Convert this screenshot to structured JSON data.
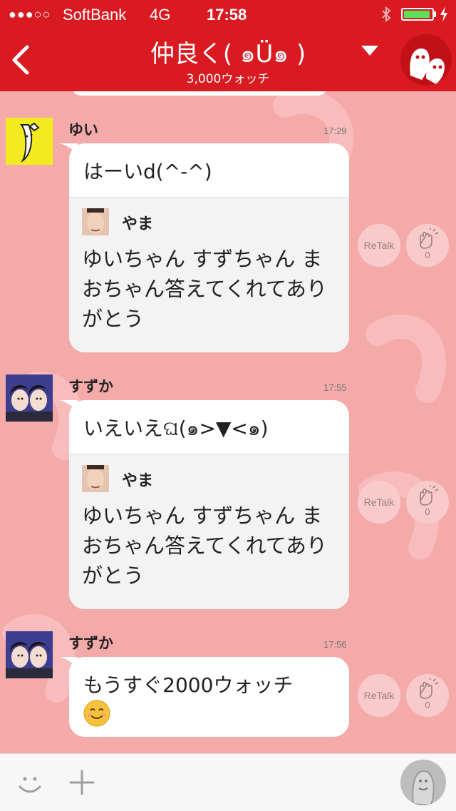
{
  "status_bar": {
    "signal": "●●●○○",
    "carrier": "SoftBank",
    "network": "4G",
    "time": "17:58"
  },
  "header": {
    "title": "仲良く( ๑Ü๑ )",
    "subtitle": "3,000ウォッチ"
  },
  "messages": [
    {
      "user": "ゆい",
      "time": "17:29",
      "text": "はーいd(^-^)",
      "quote": {
        "user": "やま",
        "text": "ゆいちゃん すずちゃん まおちゃん答えてくれてありがとう"
      },
      "retalk_label": "ReTalk",
      "clap_count": "0"
    },
    {
      "user": "すずか",
      "time": "17:55",
      "text": "いえいえଘ(๑>▼<๑)",
      "quote": {
        "user": "やま",
        "text": "ゆいちゃん すずちゃん まおちゃん答えてくれてありがとう"
      },
      "retalk_label": "ReTalk",
      "clap_count": "0"
    },
    {
      "user": "すずか",
      "time": "17:56",
      "text": "もうすぐ2000ウォッチ",
      "retalk_label": "ReTalk",
      "clap_count": "0"
    }
  ],
  "icons": {
    "back": "chevron-left-icon",
    "dropdown": "triangle-down-icon",
    "emoji": "smiley-icon",
    "plus": "plus-icon",
    "clap": "clap-hands-icon",
    "send": "ghost-icon"
  },
  "colors": {
    "header": "#d91a21",
    "background": "#f4aaa9",
    "bubble": "#ffffff",
    "battery": "#5fe05a"
  }
}
